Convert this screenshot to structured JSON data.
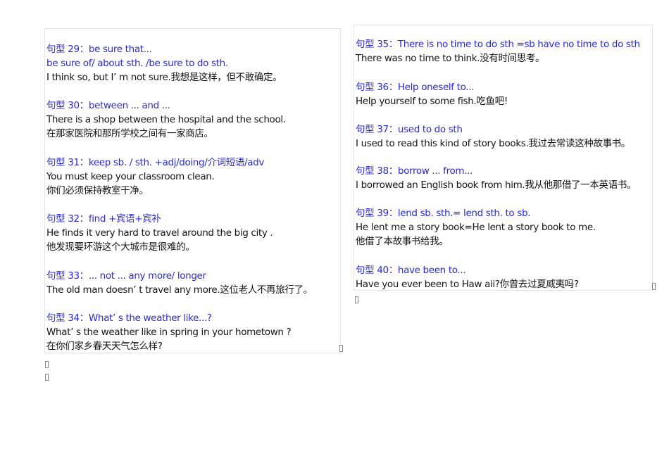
{
  "left_column": {
    "entries": [
      {
        "lines": [
          {
            "text": "句型 29：be sure that...",
            "style": "blue"
          },
          {
            "text": "be sure of/ about sth. /be sure to do sth.",
            "style": "blue"
          },
          {
            "text": "I think so, but I’ m not sure.我想是这样，但不敢确定。",
            "style": "black"
          }
        ]
      },
      {
        "lines": [
          {
            "text": "句型 30：between ... and ...",
            "style": "blue"
          },
          {
            "text": "There is a shop between the hospital and the school.",
            "style": "black"
          },
          {
            "text": "在那家医院和那所学校之间有一家商店。",
            "style": "black"
          }
        ]
      },
      {
        "lines": [
          {
            "text": "句型 31：keep sb. / sth. +adj/doing/介词短语/adv",
            "style": "blue"
          },
          {
            "text": "You must keep your classroom clean.",
            "style": "black"
          },
          {
            "text": "你们必须保持教室干净。",
            "style": "black"
          }
        ]
      },
      {
        "lines": [
          {
            "text": "句型 32：find +宾语+宾补",
            "style": "blue"
          },
          {
            "text": "He finds it very hard to travel around the big city .",
            "style": "black"
          },
          {
            "text": "他发现要环游这个大城市是很难的。",
            "style": "black"
          }
        ]
      },
      {
        "lines": [
          {
            "text": "句型 33：... not ... any more/ longer",
            "style": "blue"
          },
          {
            "text": "The old man doesn’ t travel any more.这位老人不再旅行了。",
            "style": "black"
          }
        ]
      },
      {
        "lines": [
          {
            "text": "句型 34：What’ s the weather like...?",
            "style": "blue"
          },
          {
            "text": "What’ s the weather like in spring in your hometown ?",
            "style": "black"
          },
          {
            "text": "在你们家乡春天天气怎么样?",
            "style": "black"
          }
        ]
      }
    ]
  },
  "right_column": {
    "entries": [
      {
        "lines": [
          {
            "text": "句型 35：There is no time to do sth =sb have no time to do sth",
            "style": "blue"
          },
          {
            "text": "There was no time to think.没有时间思考。",
            "style": "black"
          }
        ]
      },
      {
        "lines": [
          {
            "text": "句型 36：Help oneself to...",
            "style": "blue"
          },
          {
            "text": "Help yourself to some fish.吃鱼吧!",
            "style": "black"
          }
        ]
      },
      {
        "lines": [
          {
            "text": "句型 37：used to do sth",
            "style": "blue"
          },
          {
            "text": "I used to read this kind of story books.我过去常读这种故事书。",
            "style": "black"
          }
        ]
      },
      {
        "lines": [
          {
            "text": "句型 38：borrow ... from...",
            "style": "blue"
          },
          {
            "text": "I borrowed an English book from him.我从他那借了一本英语书。",
            "style": "black"
          }
        ]
      },
      {
        "lines": [
          {
            "text": "句型 39：lend sb. sth.= lend sth. to sb.",
            "style": "blue"
          },
          {
            "text": "He lent me a story book=He lent a story book to me.",
            "style": "black"
          },
          {
            "text": "他借了本故事书给我。",
            "style": "black"
          }
        ]
      },
      {
        "lines": [
          {
            "text": "句型 40：have been to...",
            "style": "blue"
          },
          {
            "text": "Have you ever been to Haw aii?你曾去过夏威夷吗?",
            "style": "black"
          }
        ]
      }
    ]
  }
}
